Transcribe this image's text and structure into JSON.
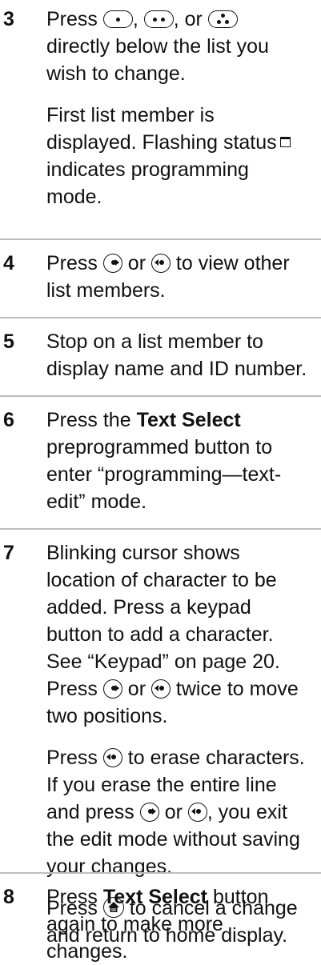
{
  "steps": [
    {
      "number": "3",
      "paragraphs": [
        {
          "parts": [
            "Press ",
            ", ",
            ", or ",
            " directly below the list you wish to change."
          ],
          "icons": [
            "one-dot-button-icon",
            "two-dot-button-icon",
            "three-dot-button-icon"
          ]
        },
        {
          "parts": [
            "First list member is displayed. Flashing status ",
            " indicates programming mode."
          ],
          "icons": [
            "status-indicator-icon"
          ]
        }
      ]
    },
    {
      "number": "4",
      "paragraphs": [
        {
          "parts": [
            "Press ",
            " or ",
            " to view other list members."
          ],
          "icons": [
            "right-arrow-button-icon",
            "left-arrow-button-icon"
          ]
        }
      ]
    },
    {
      "number": "5",
      "paragraphs": [
        {
          "parts": [
            "Stop on a list member to display name and ID number."
          ],
          "icons": []
        }
      ]
    },
    {
      "number": "6",
      "paragraphs": [
        {
          "parts": [
            "Press the ",
            "Text Select",
            " preprogrammed button to enter “programming—text-edit” mode."
          ],
          "bold_index": 1,
          "icons": []
        }
      ]
    },
    {
      "number": "7",
      "paragraphs": [
        {
          "parts": [
            "Blinking cursor shows location of character to be added. Press a keypad button to add a character. See “Keypad” on page 20. Press ",
            " or ",
            " twice to move two positions."
          ],
          "icons": [
            "right-arrow-button-icon",
            "left-arrow-button-icon"
          ]
        },
        {
          "parts": [
            "Press ",
            " to erase characters. If you erase the entire line and press ",
            " or ",
            ", you exit the edit mode without saving your changes."
          ],
          "icons": [
            "left-arrow-button-icon",
            "right-arrow-button-icon",
            "left-arrow-button-icon"
          ]
        },
        {
          "parts": [
            "Press ",
            " to cancel a change and return to home display."
          ],
          "icons": [
            "home-button-icon"
          ]
        }
      ]
    },
    {
      "number": "8",
      "paragraphs": [
        {
          "parts": [
            "Press ",
            "Text Select",
            " button again to make more changes."
          ],
          "bold_index": 1,
          "icons": []
        }
      ]
    }
  ]
}
